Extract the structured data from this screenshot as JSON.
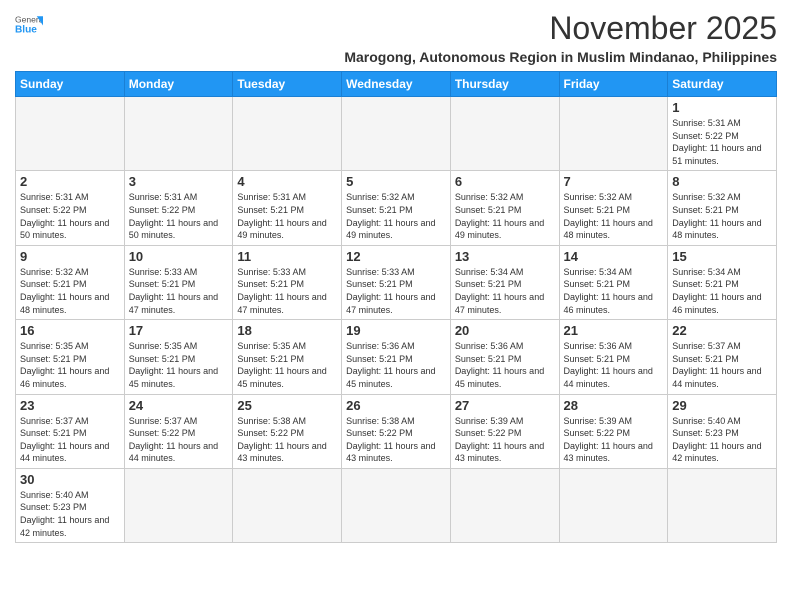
{
  "header": {
    "logo": {
      "general": "General",
      "blue": "Blue"
    },
    "title": "November 2025",
    "location": "Marogong, Autonomous Region in Muslim Mindanao, Philippines"
  },
  "weekdays": [
    "Sunday",
    "Monday",
    "Tuesday",
    "Wednesday",
    "Thursday",
    "Friday",
    "Saturday"
  ],
  "weeks": [
    [
      {
        "day": "",
        "empty": true
      },
      {
        "day": "",
        "empty": true
      },
      {
        "day": "",
        "empty": true
      },
      {
        "day": "",
        "empty": true
      },
      {
        "day": "",
        "empty": true
      },
      {
        "day": "",
        "empty": true
      },
      {
        "day": "1",
        "sunrise": "5:31 AM",
        "sunset": "5:22 PM",
        "daylight": "11 hours and 51 minutes."
      }
    ],
    [
      {
        "day": "2",
        "sunrise": "5:31 AM",
        "sunset": "5:22 PM",
        "daylight": "11 hours and 50 minutes."
      },
      {
        "day": "3",
        "sunrise": "5:31 AM",
        "sunset": "5:22 PM",
        "daylight": "11 hours and 50 minutes."
      },
      {
        "day": "4",
        "sunrise": "5:31 AM",
        "sunset": "5:21 PM",
        "daylight": "11 hours and 49 minutes."
      },
      {
        "day": "5",
        "sunrise": "5:32 AM",
        "sunset": "5:21 PM",
        "daylight": "11 hours and 49 minutes."
      },
      {
        "day": "6",
        "sunrise": "5:32 AM",
        "sunset": "5:21 PM",
        "daylight": "11 hours and 49 minutes."
      },
      {
        "day": "7",
        "sunrise": "5:32 AM",
        "sunset": "5:21 PM",
        "daylight": "11 hours and 48 minutes."
      },
      {
        "day": "8",
        "sunrise": "5:32 AM",
        "sunset": "5:21 PM",
        "daylight": "11 hours and 48 minutes."
      }
    ],
    [
      {
        "day": "9",
        "sunrise": "5:32 AM",
        "sunset": "5:21 PM",
        "daylight": "11 hours and 48 minutes."
      },
      {
        "day": "10",
        "sunrise": "5:33 AM",
        "sunset": "5:21 PM",
        "daylight": "11 hours and 47 minutes."
      },
      {
        "day": "11",
        "sunrise": "5:33 AM",
        "sunset": "5:21 PM",
        "daylight": "11 hours and 47 minutes."
      },
      {
        "day": "12",
        "sunrise": "5:33 AM",
        "sunset": "5:21 PM",
        "daylight": "11 hours and 47 minutes."
      },
      {
        "day": "13",
        "sunrise": "5:34 AM",
        "sunset": "5:21 PM",
        "daylight": "11 hours and 47 minutes."
      },
      {
        "day": "14",
        "sunrise": "5:34 AM",
        "sunset": "5:21 PM",
        "daylight": "11 hours and 46 minutes."
      },
      {
        "day": "15",
        "sunrise": "5:34 AM",
        "sunset": "5:21 PM",
        "daylight": "11 hours and 46 minutes."
      }
    ],
    [
      {
        "day": "16",
        "sunrise": "5:35 AM",
        "sunset": "5:21 PM",
        "daylight": "11 hours and 46 minutes."
      },
      {
        "day": "17",
        "sunrise": "5:35 AM",
        "sunset": "5:21 PM",
        "daylight": "11 hours and 45 minutes."
      },
      {
        "day": "18",
        "sunrise": "5:35 AM",
        "sunset": "5:21 PM",
        "daylight": "11 hours and 45 minutes."
      },
      {
        "day": "19",
        "sunrise": "5:36 AM",
        "sunset": "5:21 PM",
        "daylight": "11 hours and 45 minutes."
      },
      {
        "day": "20",
        "sunrise": "5:36 AM",
        "sunset": "5:21 PM",
        "daylight": "11 hours and 45 minutes."
      },
      {
        "day": "21",
        "sunrise": "5:36 AM",
        "sunset": "5:21 PM",
        "daylight": "11 hours and 44 minutes."
      },
      {
        "day": "22",
        "sunrise": "5:37 AM",
        "sunset": "5:21 PM",
        "daylight": "11 hours and 44 minutes."
      }
    ],
    [
      {
        "day": "23",
        "sunrise": "5:37 AM",
        "sunset": "5:21 PM",
        "daylight": "11 hours and 44 minutes."
      },
      {
        "day": "24",
        "sunrise": "5:37 AM",
        "sunset": "5:22 PM",
        "daylight": "11 hours and 44 minutes."
      },
      {
        "day": "25",
        "sunrise": "5:38 AM",
        "sunset": "5:22 PM",
        "daylight": "11 hours and 43 minutes."
      },
      {
        "day": "26",
        "sunrise": "5:38 AM",
        "sunset": "5:22 PM",
        "daylight": "11 hours and 43 minutes."
      },
      {
        "day": "27",
        "sunrise": "5:39 AM",
        "sunset": "5:22 PM",
        "daylight": "11 hours and 43 minutes."
      },
      {
        "day": "28",
        "sunrise": "5:39 AM",
        "sunset": "5:22 PM",
        "daylight": "11 hours and 43 minutes."
      },
      {
        "day": "29",
        "sunrise": "5:40 AM",
        "sunset": "5:23 PM",
        "daylight": "11 hours and 42 minutes."
      }
    ],
    [
      {
        "day": "30",
        "sunrise": "5:40 AM",
        "sunset": "5:23 PM",
        "daylight": "11 hours and 42 minutes."
      },
      {
        "day": "",
        "empty": true
      },
      {
        "day": "",
        "empty": true
      },
      {
        "day": "",
        "empty": true
      },
      {
        "day": "",
        "empty": true
      },
      {
        "day": "",
        "empty": true
      },
      {
        "day": "",
        "empty": true
      }
    ]
  ]
}
